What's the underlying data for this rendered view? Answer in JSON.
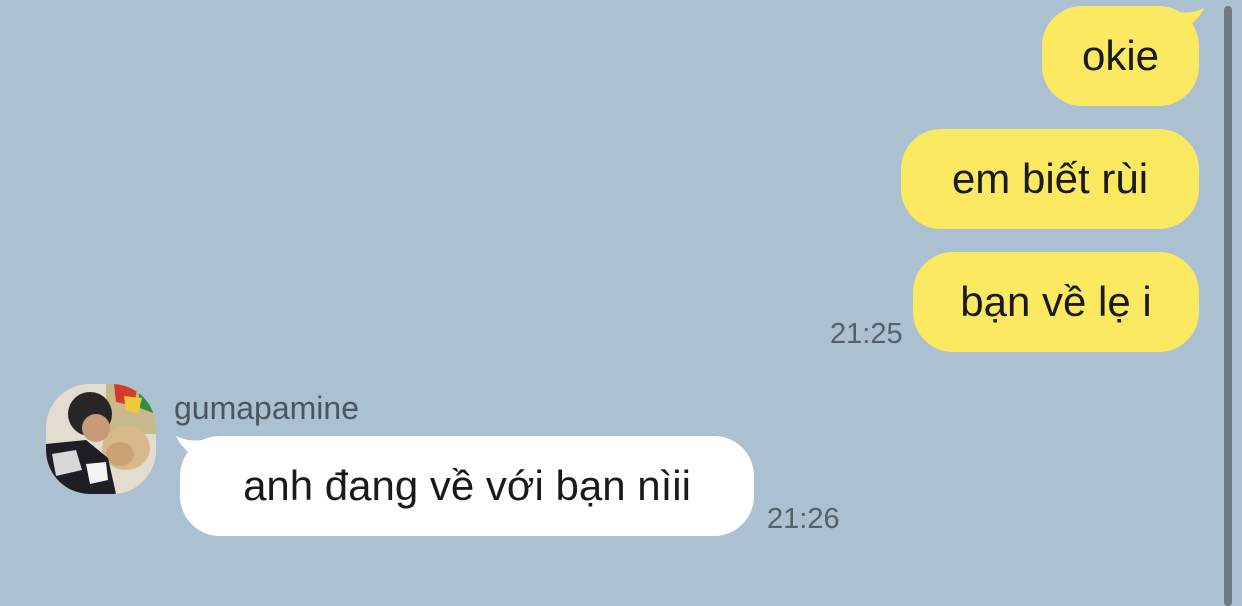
{
  "messages_out": [
    {
      "text": "okie"
    },
    {
      "text": "em biết rùi"
    },
    {
      "text": "bạn về lẹ i",
      "time": "21:25"
    }
  ],
  "message_in": {
    "sender": "gumapamine",
    "text": "anh đang về với bạn nìii",
    "time": "21:26"
  },
  "colors": {
    "background": "#abc1d1",
    "outgoing_bubble": "#fbe961",
    "incoming_bubble": "#ffffff"
  },
  "icons": {
    "avatar": "user-avatar-photo"
  }
}
